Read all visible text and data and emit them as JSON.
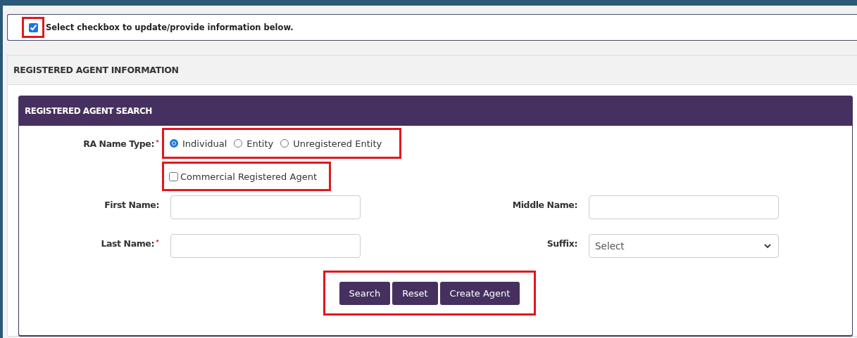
{
  "update_notice": {
    "checked": true,
    "highlighted": true,
    "text": "Select checkbox to update/provide information below."
  },
  "section": {
    "title": "REGISTERED AGENT INFORMATION"
  },
  "search_card": {
    "title": "REGISTERED AGENT SEARCH",
    "ra_name_type": {
      "label": "RA Name Type:",
      "required": true,
      "highlighted": true,
      "options": [
        {
          "label": "Individual",
          "selected": true
        },
        {
          "label": "Entity",
          "selected": false
        },
        {
          "label": "Unregistered Entity",
          "selected": false
        }
      ]
    },
    "commercial_agent": {
      "label": "Commercial Registered Agent",
      "checked": false,
      "highlighted": true
    },
    "fields": [
      {
        "kind": "text",
        "label": "First Name:",
        "required": false
      },
      {
        "kind": "text",
        "label": "Middle Name:",
        "required": false
      },
      {
        "kind": "text",
        "label": "Last Name:",
        "required": true
      },
      {
        "kind": "select",
        "label": "Suffix:",
        "required": false,
        "value": "Select"
      }
    ],
    "buttons": {
      "highlighted": true,
      "items": [
        "Search",
        "Reset",
        "Create Agent"
      ]
    }
  }
}
